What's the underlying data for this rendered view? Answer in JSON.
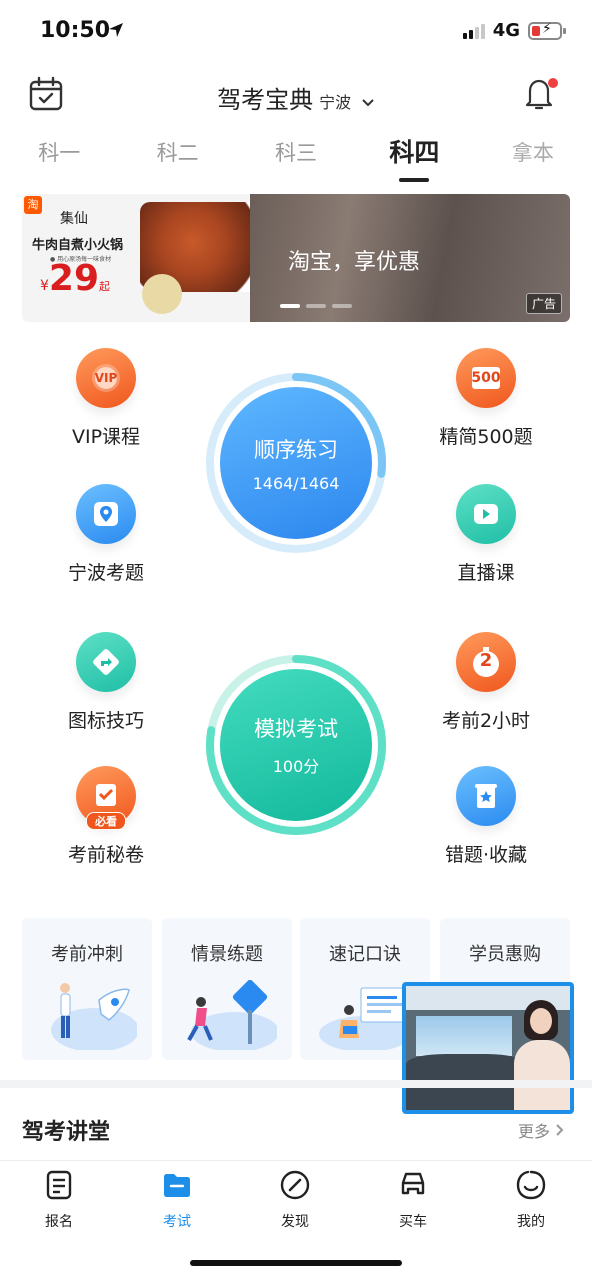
{
  "status_bar": {
    "time": "10:50",
    "network": "4G"
  },
  "header": {
    "title": "驾考宝典",
    "city": "宁波"
  },
  "tabs": [
    {
      "label": "科一",
      "active": false
    },
    {
      "label": "科二",
      "active": false
    },
    {
      "label": "科三",
      "active": false
    },
    {
      "label": "科四",
      "active": true
    },
    {
      "label": "拿本",
      "active": false
    }
  ],
  "banner": {
    "badge": "淘",
    "brand": "集仙",
    "product": "牛肉自煮小火锅",
    "small_text": "● 用心原汤每一味食材",
    "price_symbol": "¥",
    "price": "29",
    "price_suffix": "起",
    "headline": "淘宝，享优惠",
    "ad_tag": "广告"
  },
  "features": {
    "vip": "VIP课程",
    "vip_badge": "VIP",
    "jingjian": "精简500题",
    "jingjian_badge": "500",
    "ningbo": "宁波考题",
    "live": "直播课",
    "sign": "图标技巧",
    "two_hours": "考前2小时",
    "two_badge": "2",
    "secret": "考前秘卷",
    "secret_badge": "必看",
    "wrong": "错题·收藏"
  },
  "practice": {
    "title": "顺序练习",
    "progress": "1464/1464",
    "progress_fraction": 1.0
  },
  "exam": {
    "title": "模拟考试",
    "score": "100分"
  },
  "cards": [
    "考前冲刺",
    "情景练题",
    "速记口诀",
    "学员惠购"
  ],
  "coin_symbol": "¥",
  "section": {
    "title": "驾考讲堂",
    "more": "更多"
  },
  "bottom_nav": [
    {
      "label": "报名",
      "icon": "document-icon",
      "active": false
    },
    {
      "label": "考试",
      "icon": "folder-icon",
      "active": true
    },
    {
      "label": "发现",
      "icon": "compass-icon",
      "active": false
    },
    {
      "label": "买车",
      "icon": "car-icon",
      "active": false
    },
    {
      "label": "我的",
      "icon": "smile-icon",
      "active": false
    }
  ],
  "colors": {
    "accent_blue": "#1e8fe8",
    "accent_teal": "#22c8a8",
    "accent_orange": "#f5661f",
    "notify_red": "#f04040"
  }
}
